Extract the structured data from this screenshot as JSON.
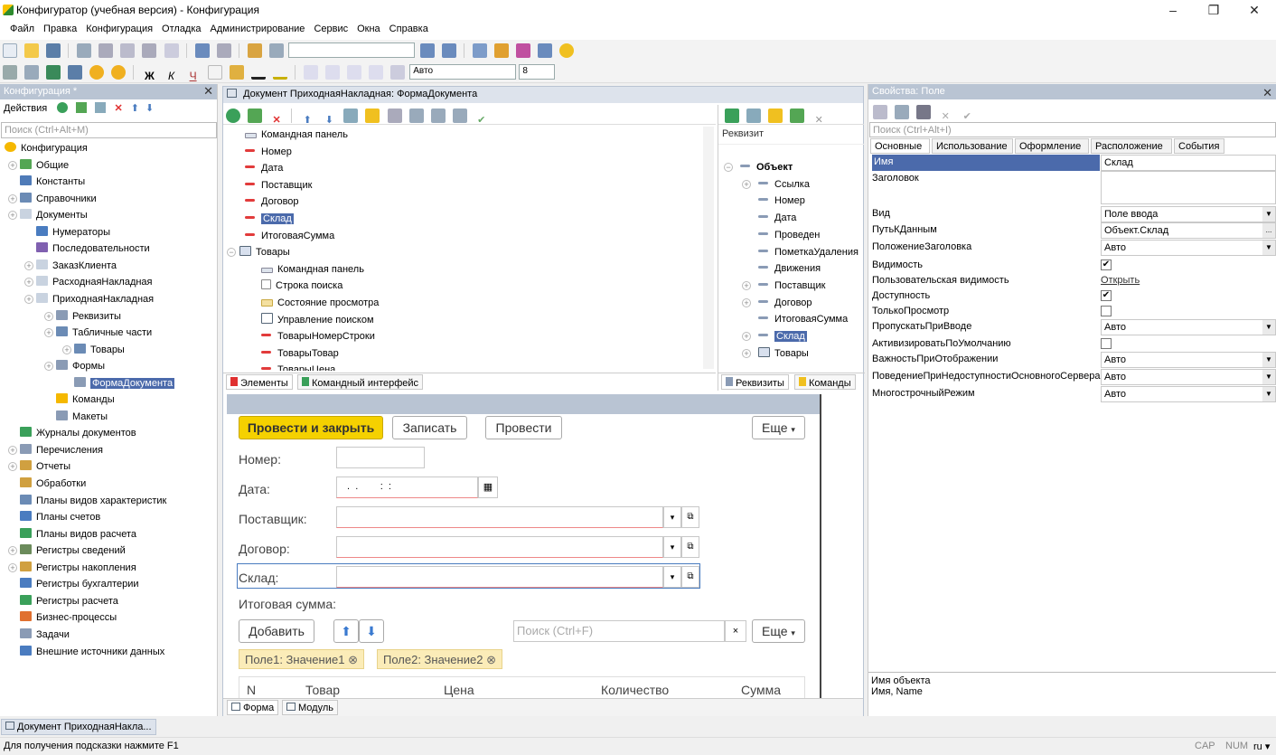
{
  "window": {
    "title": "Конфигуратор (учебная версия) - Конфигурация"
  },
  "menu": [
    "Файл",
    "Правка",
    "Конфигурация",
    "Отладка",
    "Администрирование",
    "Сервис",
    "Окна",
    "Справка"
  ],
  "toolbar2": {
    "font_value": "Авто",
    "size_value": "8"
  },
  "left_panel": {
    "title": "Конфигурация *",
    "actions_label": "Действия",
    "search_placeholder": "Поиск (Ctrl+Alt+M)",
    "tree": [
      {
        "label": "Конфигурация",
        "level": 0,
        "icon": "config-icon",
        "color": "#f5b800"
      },
      {
        "label": "Общие",
        "level": 1,
        "icon": "common-icon",
        "color": "#54a654",
        "exp": true
      },
      {
        "label": "Константы",
        "level": 1,
        "icon": "constants-icon",
        "color": "#4f7bb8"
      },
      {
        "label": "Справочники",
        "level": 1,
        "icon": "catalogs-icon",
        "color": "#6b8bb5",
        "exp": true
      },
      {
        "label": "Документы",
        "level": 1,
        "icon": "documents-icon",
        "color": "#c9d3e0",
        "exp": true
      },
      {
        "label": "Нумераторы",
        "level": 2,
        "icon": "numerators-icon",
        "color": "#4a7cc0"
      },
      {
        "label": "Последовательности",
        "level": 2,
        "icon": "sequences-icon",
        "color": "#8060b0"
      },
      {
        "label": "ЗаказКлиента",
        "level": 2,
        "icon": "document-icon",
        "color": "#c9d3e0",
        "exp": true
      },
      {
        "label": "РасходнаяНакладная",
        "level": 2,
        "icon": "document-icon",
        "color": "#c9d3e0",
        "exp": true
      },
      {
        "label": "ПриходнаяНакладная",
        "level": 2,
        "icon": "document-icon",
        "color": "#c9d3e0",
        "exp": true
      },
      {
        "label": "Реквизиты",
        "level": 3,
        "icon": "attributes-icon",
        "color": "#8a9bb5",
        "exp": true
      },
      {
        "label": "Табличные части",
        "level": 3,
        "icon": "tabular-icon",
        "color": "#6b8bb5",
        "exp": true
      },
      {
        "label": "Товары",
        "level": 4,
        "icon": "table-icon",
        "color": "#6b8bb5",
        "exp": true
      },
      {
        "label": "Формы",
        "level": 3,
        "icon": "forms-icon",
        "color": "#8a9bb5",
        "exp": true
      },
      {
        "label": "ФормаДокумента",
        "level": 4,
        "icon": "form-icon",
        "color": "#8a9bb5",
        "selected": true
      },
      {
        "label": "Команды",
        "level": 3,
        "icon": "commands-icon",
        "color": "#f5b800"
      },
      {
        "label": "Макеты",
        "level": 3,
        "icon": "templates-icon",
        "color": "#8a9bb5"
      },
      {
        "label": "Журналы документов",
        "level": 1,
        "icon": "journals-icon",
        "color": "#3aa05a"
      },
      {
        "label": "Перечисления",
        "level": 1,
        "icon": "enums-icon",
        "color": "#8a9bb5",
        "exp": true
      },
      {
        "label": "Отчеты",
        "level": 1,
        "icon": "reports-icon",
        "color": "#d0a040",
        "exp": true
      },
      {
        "label": "Обработки",
        "level": 1,
        "icon": "dataprocessors-icon",
        "color": "#d0a040"
      },
      {
        "label": "Планы видов характеристик",
        "level": 1,
        "icon": "chartsofchar-icon",
        "color": "#6b8bb5"
      },
      {
        "label": "Планы счетов",
        "level": 1,
        "icon": "chartsofaccounts-icon",
        "color": "#4a7cc0"
      },
      {
        "label": "Планы видов расчета",
        "level": 1,
        "icon": "calctypes-icon",
        "color": "#3aa05a"
      },
      {
        "label": "Регистры сведений",
        "level": 1,
        "icon": "inforegisters-icon",
        "color": "#6b8b5b",
        "exp": true
      },
      {
        "label": "Регистры накопления",
        "level": 1,
        "icon": "accumregisters-icon",
        "color": "#d0a040",
        "exp": true
      },
      {
        "label": "Регистры бухгалтерии",
        "level": 1,
        "icon": "accountingregisters-icon",
        "color": "#4a7cc0"
      },
      {
        "label": "Регистры расчета",
        "level": 1,
        "icon": "calcregisters-icon",
        "color": "#3aa05a"
      },
      {
        "label": "Бизнес-процессы",
        "level": 1,
        "icon": "businessprocesses-icon",
        "color": "#e07030"
      },
      {
        "label": "Задачи",
        "level": 1,
        "icon": "tasks-icon",
        "color": "#8a9bb5"
      },
      {
        "label": "Внешние источники данных",
        "level": 1,
        "icon": "externalsources-icon",
        "color": "#4a7cc0"
      }
    ]
  },
  "editor": {
    "title": "Документ ПриходнаяНакладная: ФормаДокумента",
    "elements": [
      {
        "label": "Командная панель",
        "type": "cmd",
        "level": 0
      },
      {
        "label": "Номер",
        "type": "field",
        "level": 0
      },
      {
        "label": "Дата",
        "type": "field",
        "level": 0
      },
      {
        "label": "Поставщик",
        "type": "field",
        "level": 0
      },
      {
        "label": "Договор",
        "type": "field",
        "level": 0
      },
      {
        "label": "Склад",
        "type": "field",
        "level": 0,
        "selected": true
      },
      {
        "label": "ИтоговаяСумма",
        "type": "field",
        "level": 0
      },
      {
        "label": "Товары",
        "type": "table",
        "level": -1
      },
      {
        "label": "Командная панель",
        "type": "cmd",
        "level": 1
      },
      {
        "label": "Строка поиска",
        "type": "search",
        "level": 1
      },
      {
        "label": "Состояние просмотра",
        "type": "state",
        "level": 1
      },
      {
        "label": "Управление поиском",
        "type": "searchctl",
        "level": 1
      },
      {
        "label": "ТоварыНомерСтроки",
        "type": "field",
        "level": 1
      },
      {
        "label": "ТоварыТовар",
        "type": "field",
        "level": 1
      },
      {
        "label": "ТоварыЦена",
        "type": "field",
        "level": 1
      }
    ],
    "tabs_left": [
      "Элементы",
      "Командный интерфейс"
    ],
    "attributes_header": "Реквизит",
    "attributes": [
      {
        "label": "Объект",
        "level": 0,
        "bold": true
      },
      {
        "label": "Ссылка",
        "level": 1,
        "exp": true
      },
      {
        "label": "Номер",
        "level": 1
      },
      {
        "label": "Дата",
        "level": 1
      },
      {
        "label": "Проведен",
        "level": 1
      },
      {
        "label": "ПометкаУдаления",
        "level": 1
      },
      {
        "label": "Движения",
        "level": 1
      },
      {
        "label": "Поставщик",
        "level": 1,
        "exp": true
      },
      {
        "label": "Договор",
        "level": 1,
        "exp": true
      },
      {
        "label": "ИтоговаяСумма",
        "level": 1
      },
      {
        "label": "Склад",
        "level": 1,
        "exp": true,
        "selected": true
      },
      {
        "label": "Товары",
        "level": 1,
        "exp": true,
        "table": true
      }
    ],
    "tabs_right": [
      "Реквизиты",
      "Команды"
    ],
    "bottom_tabs": [
      "Форма",
      "Модуль"
    ]
  },
  "form_preview": {
    "buttons": {
      "post_close": "Провести и закрыть",
      "write": "Записать",
      "post": "Провести",
      "more": "Еще"
    },
    "labels": {
      "number": "Номер:",
      "date": "Дата:",
      "supplier": "Поставщик:",
      "contract": "Договор:",
      "warehouse": "Склад:",
      "total": "Итоговая сумма:"
    },
    "date_mask": " .  .        :  :",
    "table_toolbar": {
      "add": "Добавить",
      "search_placeholder": "Поиск (Ctrl+F)",
      "more": "Еще"
    },
    "filters": [
      "Поле1: Значение1",
      "Поле2: Значение2"
    ],
    "columns": [
      "N",
      "Товар",
      "Цена",
      "Количество",
      "Сумма"
    ]
  },
  "properties": {
    "title": "Свойства: Поле",
    "search_placeholder": "Поиск (Ctrl+Alt+I)",
    "tabs": [
      "Основные",
      "Использование",
      "Оформление",
      "Расположение",
      "События"
    ],
    "rows": [
      {
        "name": "Имя",
        "value": "Склад",
        "kind": "text",
        "selected": true
      },
      {
        "name": "Заголовок",
        "value": "",
        "kind": "multiline"
      },
      {
        "name": "Вид",
        "value": "Поле ввода",
        "kind": "select"
      },
      {
        "name": "ПутьКДанным",
        "value": "Объект.Склад",
        "kind": "path"
      },
      {
        "name": "ПоложениеЗаголовка",
        "value": "Авто",
        "kind": "select"
      },
      {
        "name": "Видимость",
        "value": "✔",
        "kind": "check"
      },
      {
        "name": "Пользовательская видимость",
        "value": "Открыть",
        "kind": "link"
      },
      {
        "name": "Доступность",
        "value": "✔",
        "kind": "check"
      },
      {
        "name": "ТолькоПросмотр",
        "value": "",
        "kind": "check"
      },
      {
        "name": "ПропускатьПриВводе",
        "value": "Авто",
        "kind": "select"
      },
      {
        "name": "АктивизироватьПоУмолчанию",
        "value": "",
        "kind": "check"
      },
      {
        "name": "ВажностьПриОтображении",
        "value": "Авто",
        "kind": "select"
      },
      {
        "name": "ПоведениеПриНедоступностиОсновногоСервера",
        "value": "Авто",
        "kind": "select"
      },
      {
        "name": "МногострочныйРежим",
        "value": "Авто",
        "kind": "select"
      }
    ],
    "hint_title": "Имя объекта",
    "hint_text": "Имя, Name"
  },
  "taskbar": {
    "window_tab": "Документ ПриходнаяНакла..."
  },
  "status": {
    "hint": "Для получения подсказки нажмите F1",
    "cap": "CAP",
    "num": "NUM",
    "lang": "ru"
  },
  "colors": {
    "accent_yellow": "#f5d100",
    "selection": "#4b6aab",
    "panel_head": "#b9c4d3"
  }
}
